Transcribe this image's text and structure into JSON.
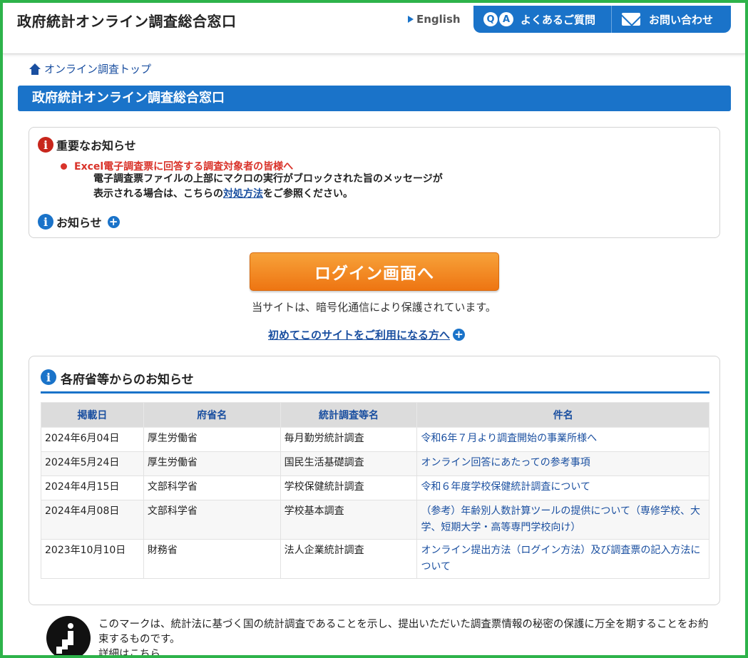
{
  "header": {
    "site_title": "政府統計オンライン調査総合窓口",
    "english_label": "English",
    "faq_label": "よくあるご質問",
    "contact_label": "お問い合わせ"
  },
  "breadcrumb": {
    "label": "オンライン調査トップ"
  },
  "title_bar": {
    "label": "政府統計オンライン調査総合窓口"
  },
  "notice": {
    "heading": "重要なお知らせ",
    "item_title": "Excel電子調査票に回答する調査対象者の皆様へ",
    "body_line1": "電子調査票ファイルの上部にマクロの実行がブロックされた旨のメッセージが",
    "body_line2_pre": "表示される場合は、こちらの",
    "body_link": "対処方法",
    "body_line2_post": "をご参照ください。",
    "sub_heading": "お知らせ"
  },
  "login": {
    "button_label": "ログイン画面へ",
    "secure_text": "当サイトは、暗号化通信により保護されています。",
    "first_time_label": "初めてこのサイトをご利用になる方へ"
  },
  "news": {
    "heading": "各府省等からのお知らせ",
    "columns": [
      "掲載日",
      "府省名",
      "統計調査等名",
      "件名"
    ],
    "rows": [
      {
        "date": "2024年6月04日",
        "ministry": "厚生労働省",
        "survey": "毎月勤労統計調査",
        "subject": "令和6年７月より調査開始の事業所様へ"
      },
      {
        "date": "2024年5月24日",
        "ministry": "厚生労働省",
        "survey": "国民生活基礎調査",
        "subject": "オンライン回答にあたっての参考事項"
      },
      {
        "date": "2024年4月15日",
        "ministry": "文部科学省",
        "survey": "学校保健統計調査",
        "subject": "令和６年度学校保健統計調査について"
      },
      {
        "date": "2024年4月08日",
        "ministry": "文部科学省",
        "survey": "学校基本調査",
        "subject": "（参考）年齢別人数計算ツールの提供について（専修学校、大学、短期大学・高等専門学校向け）"
      },
      {
        "date": "2023年10月10日",
        "ministry": "財務省",
        "survey": "法人企業統計調査",
        "subject": "オンライン提出方法（ログイン方法）及び調査票の記入方法について"
      }
    ]
  },
  "footer": {
    "text": "このマークは、統計法に基づく国の統計調査であることを示し、提出いただいた調査票情報の秘密の保護に万全を期することをお約束するものです。",
    "more": "詳細はこちら"
  },
  "icons": {
    "faq": "qa-icon",
    "contact": "mail-icon",
    "breadcrumb": "home-icon",
    "notice": "warning-icon",
    "info": "info-icon",
    "expand": "plus-icon"
  },
  "colors": {
    "brand_blue": "#1a73c9",
    "login_orange": "#ee7512",
    "alert_red": "#d9332a",
    "frame_green": "#2db34a"
  }
}
